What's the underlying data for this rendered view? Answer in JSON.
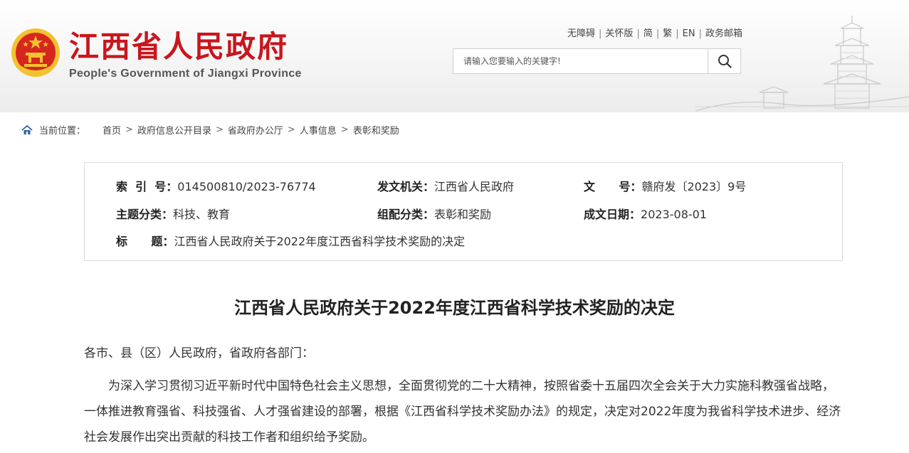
{
  "header": {
    "title": "江西省人民政府",
    "subtitle": "People's Government of Jiangxi Province",
    "links": [
      "无障碍",
      "关怀版",
      "简",
      "繁",
      "EN",
      "政务邮箱"
    ],
    "search_placeholder": "请输入您要输入的关键字!"
  },
  "breadcrumb": {
    "label": "当前位置：",
    "items": [
      "首页",
      "政府信息公开目录",
      "省政府办公厅",
      "人事信息",
      "表彰和奖励"
    ],
    "arrow": ">"
  },
  "info": {
    "index_label": "索  引  号：",
    "index_value": "014500810/2023-76774",
    "issuer_label": "发文机关：",
    "issuer_value": "江西省人民政府",
    "docno_label": "文      号：",
    "docno_value": "赣府发〔2023〕9号",
    "topic_label": "主题分类：",
    "topic_value": "科技、教育",
    "category_label": "组配分类：",
    "category_value": "表彰和奖励",
    "date_label": "成文日期：",
    "date_value": "2023-08-01",
    "title_label": "标      题：",
    "title_value": "江西省人民政府关于2022年度江西省科学技术奖励的决定"
  },
  "article": {
    "title": "江西省人民政府关于2022年度江西省科学技术奖励的决定",
    "salutation": "各市、县（区）人民政府，省政府各部门：",
    "paragraph1": "为深入学习贯彻习近平新时代中国特色社会主义思想，全面贯彻党的二十大精神，按照省委十五届四次全会关于大力实施科教强省战略，一体推进教育强省、科技强省、人才强省建设的部署，根据《江西省科学技术奖励办法》的规定，决定对2022年度为我省科学技术进步、经济社会发展作出突出贡献的科技工作者和组织给予奖励。"
  },
  "colors": {
    "brand_red": "#c8161d",
    "emblem_gold": "#f2c230",
    "border": "#d9d9d9"
  }
}
